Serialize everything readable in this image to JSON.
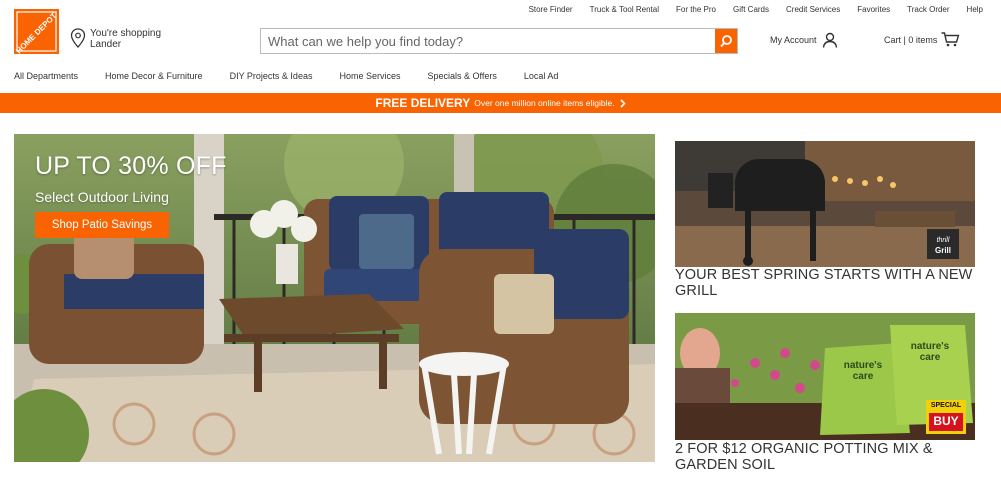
{
  "header": {
    "logo_text": "THE HOME DEPOT",
    "store_line1": "You're shopping",
    "store_line2": "Lander",
    "search_placeholder": "What can we help you find today?",
    "account_label": "My Account",
    "cart_label": "Cart | 0 items",
    "top_links": [
      "Store Finder",
      "Truck & Tool Rental",
      "For the Pro",
      "Gift Cards",
      "Credit Services",
      "Favorites",
      "Track Order",
      "Help"
    ]
  },
  "nav": {
    "items": [
      "All Departments",
      "Home Decor & Furniture",
      "DIY Projects & Ideas",
      "Home Services",
      "Specials & Offers",
      "Local Ad"
    ]
  },
  "promo_bar": {
    "headline": "FREE DELIVERY",
    "detail": "Over one million online items eligible."
  },
  "hero": {
    "headline": "UP TO 30% OFF",
    "subhead": "Select Outdoor Living",
    "cta": "Shop Patio Savings"
  },
  "tiles": [
    {
      "caption": "YOUR BEST SPRING STARTS WITH A NEW GRILL",
      "badge": "thrill Grill"
    },
    {
      "caption": "2 FOR $12 ORGANIC POTTING MIX & GARDEN SOIL",
      "badge_top": "SPECIAL",
      "badge_bottom": "BUY",
      "bag_label": "nature's care"
    }
  ],
  "colors": {
    "brand_orange": "#f96302"
  }
}
